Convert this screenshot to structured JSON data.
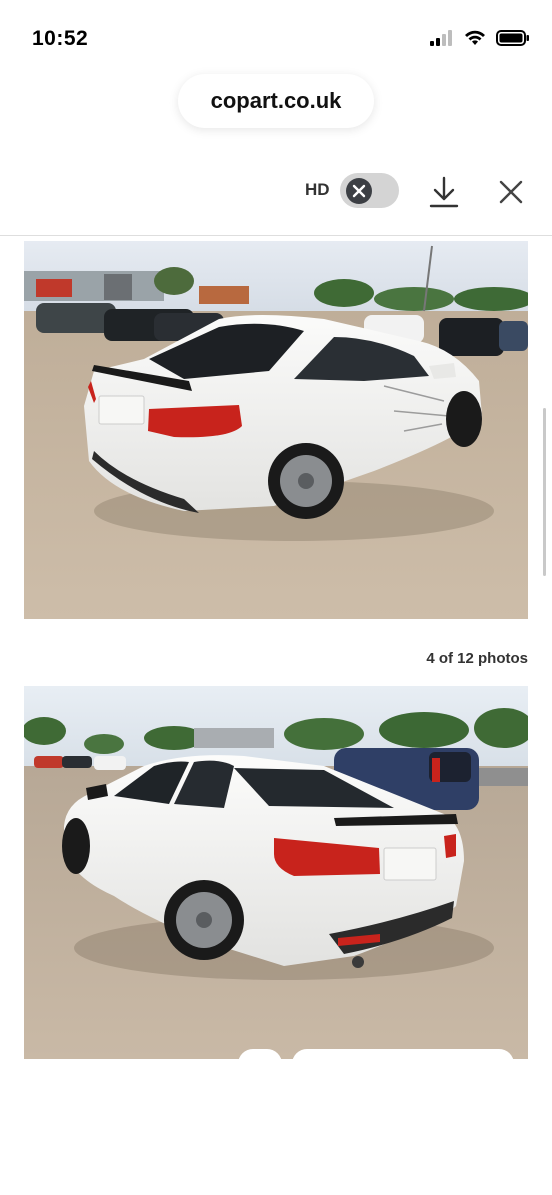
{
  "status_bar": {
    "time": "10:52",
    "icons": [
      "cellular-signal-icon",
      "wifi-icon",
      "battery-icon"
    ]
  },
  "browser": {
    "url": "copart.co.uk"
  },
  "viewer_toolbar": {
    "hd_label": "HD",
    "hd_toggle_icon": "close-icon",
    "download_icon": "download-icon",
    "close_icon": "close-icon"
  },
  "gallery": {
    "photo_counter": "4 of 12 photos",
    "photos": [
      {
        "name": "vehicle-photo-rear-right",
        "subject": "white coupe in lot"
      },
      {
        "name": "vehicle-photo-rear-left",
        "subject": "white coupe in lot"
      }
    ]
  },
  "colors": {
    "car_white": "#f2f2f0",
    "tail_light": "#c8231c",
    "ground": "#c9b9a6",
    "sky": "#dfe6ee",
    "toggle_track": "#d4d4d4",
    "toggle_knob": "#3c3f44"
  }
}
